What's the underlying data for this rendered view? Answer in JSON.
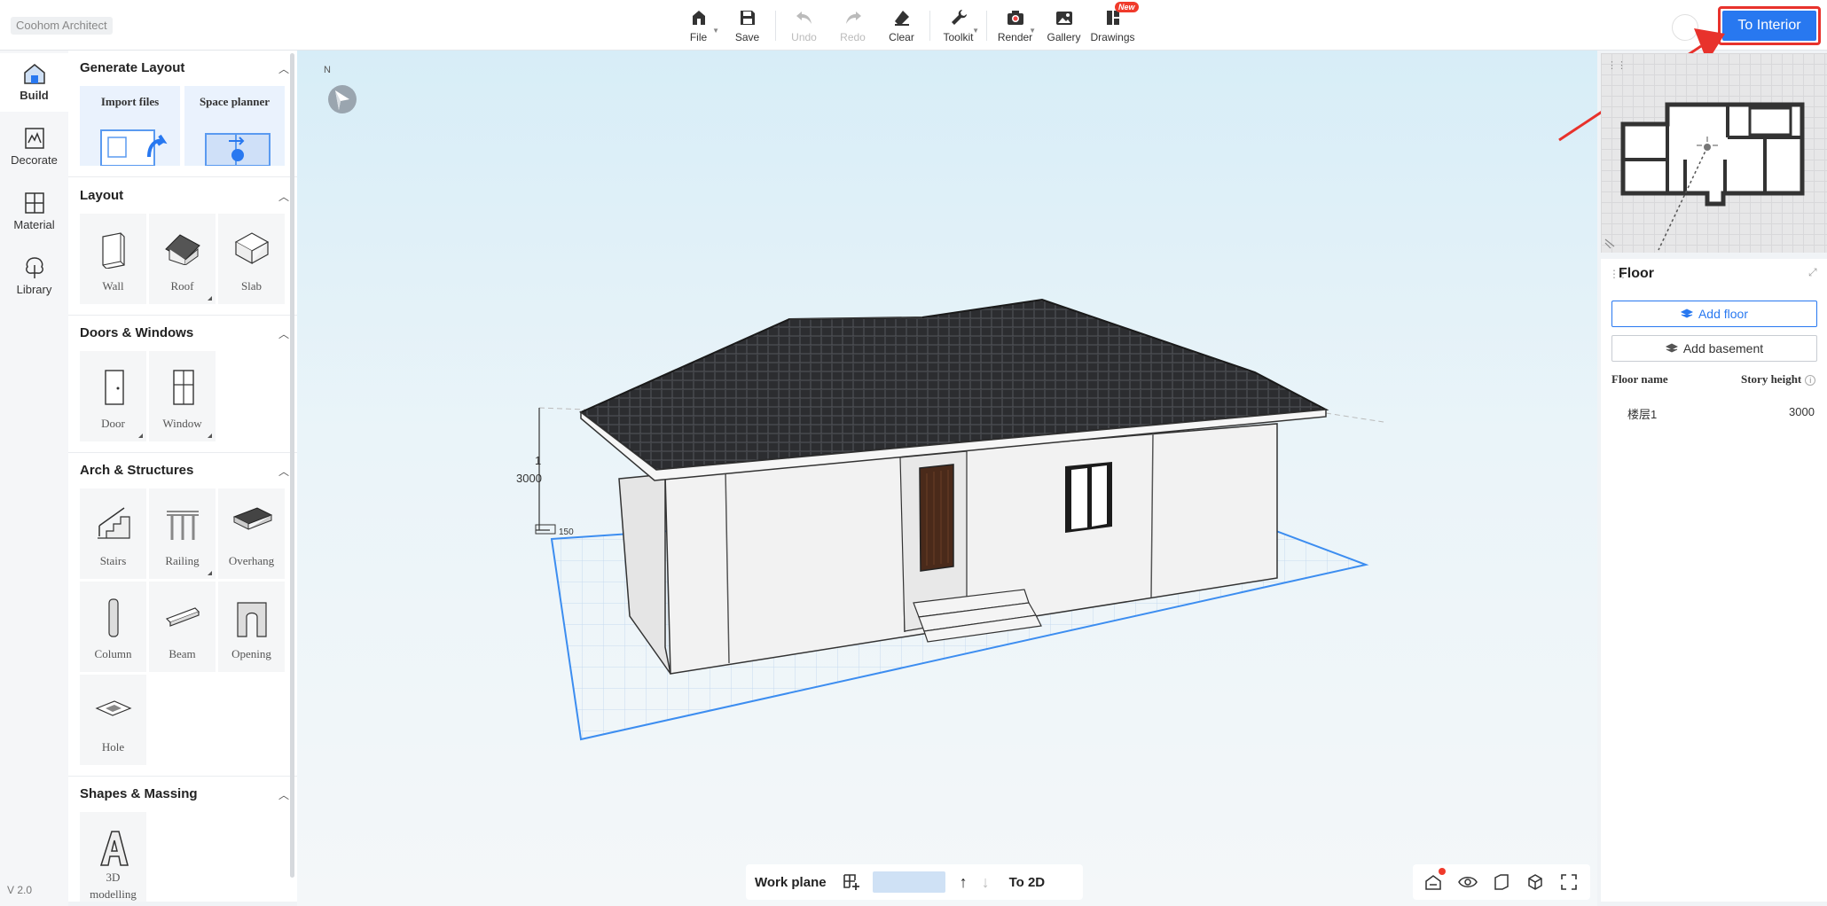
{
  "app": {
    "brand": "Coohom Architect",
    "version": "V 2.0"
  },
  "toolbar": {
    "file": "File",
    "save": "Save",
    "undo": "Undo",
    "redo": "Redo",
    "clear": "Clear",
    "toolkit": "Toolkit",
    "render": "Render",
    "gallery": "Gallery",
    "drawings": "Drawings",
    "new_badge": "New"
  },
  "header": {
    "to_interior": "To Interior"
  },
  "rail": {
    "build": "Build",
    "decorate": "Decorate",
    "material": "Material",
    "library": "Library"
  },
  "panel": {
    "generate_layout": {
      "title": "Generate Layout",
      "import_files": "Import files",
      "space_planner": "Space planner"
    },
    "layout": {
      "title": "Layout",
      "wall": "Wall",
      "roof": "Roof",
      "slab": "Slab"
    },
    "doors_windows": {
      "title": "Doors & Windows",
      "door": "Door",
      "window": "Window"
    },
    "arch_structures": {
      "title": "Arch & Structures",
      "stairs": "Stairs",
      "railing": "Railing",
      "overhang": "Overhang",
      "column": "Column",
      "beam": "Beam",
      "opening": "Opening",
      "hole": "Hole"
    },
    "shapes_massing": {
      "title": "Shapes & Massing",
      "modelling_1": "3D",
      "modelling_2": "modelling"
    }
  },
  "viewport": {
    "north": "N",
    "dimension_height": "3000",
    "dimension_small": "150",
    "dimension_label": "1"
  },
  "bottombar": {
    "work_plane": "Work plane",
    "to_2d": "To 2D"
  },
  "floor_panel": {
    "title": "Floor",
    "add_floor": "Add floor",
    "add_basement": "Add basement",
    "col_name": "Floor name",
    "col_height": "Story height",
    "rows": [
      {
        "name": "楼层1",
        "height": "3000"
      }
    ]
  },
  "colors": {
    "accent": "#2878f0",
    "highlight": "#e8322c",
    "badge": "#f03a2b"
  }
}
